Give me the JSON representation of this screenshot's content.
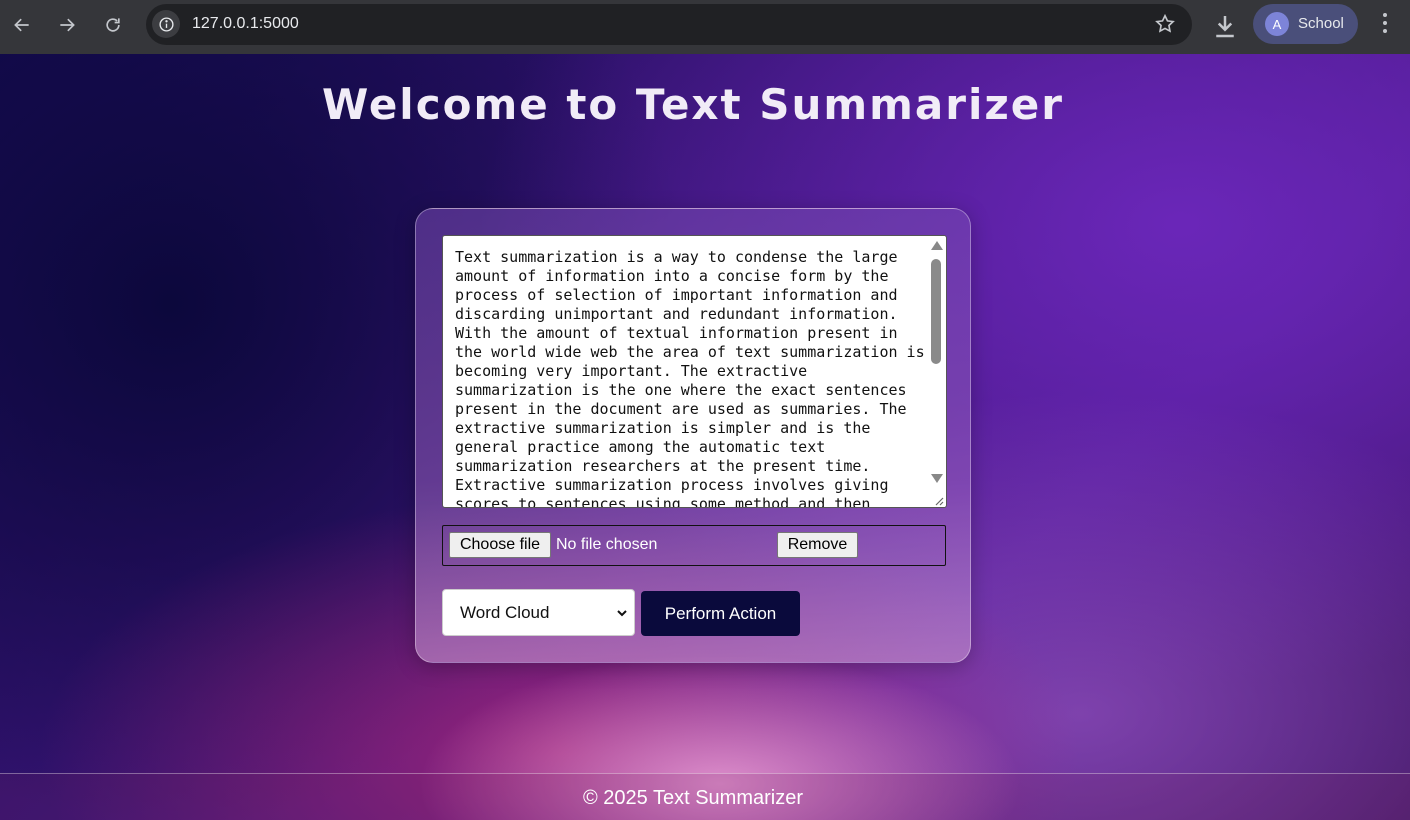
{
  "browser": {
    "url": "127.0.0.1:5000",
    "profile_initial": "A",
    "profile_name": "School",
    "icons": [
      "back-arrow-icon",
      "forward-arrow-icon",
      "reload-icon",
      "site-info-icon",
      "bookmark-star-icon",
      "download-icon",
      "kebab-menu-icon"
    ]
  },
  "page": {
    "title": "Welcome to Text Summarizer",
    "textarea_value": "Text summarization is a way to condense the large amount of information into a concise form by the process of selection of important information and discarding unimportant and redundant information. With the amount of textual information present in the world wide web the area of text summarization is becoming very important. The extractive summarization is the one where the exact sentences present in the document are used as summaries. The extractive summarization is simpler and is the general practice among the automatic text summarization researchers at the present time. Extractive summarization process involves giving scores to sentences using some method and then",
    "choose_file_label": "Choose file",
    "no_file_text": "No file chosen",
    "remove_label": "Remove",
    "select_value": "Word Cloud",
    "action_label": "Perform Action",
    "footer": "© 2025 Text Summarizer"
  },
  "colors": {
    "chrome_bg": "#35363a",
    "omnibox_bg": "#202124",
    "action_button_bg": "#0a0a3c",
    "profile_chip_bg": "#4a4f7a"
  }
}
